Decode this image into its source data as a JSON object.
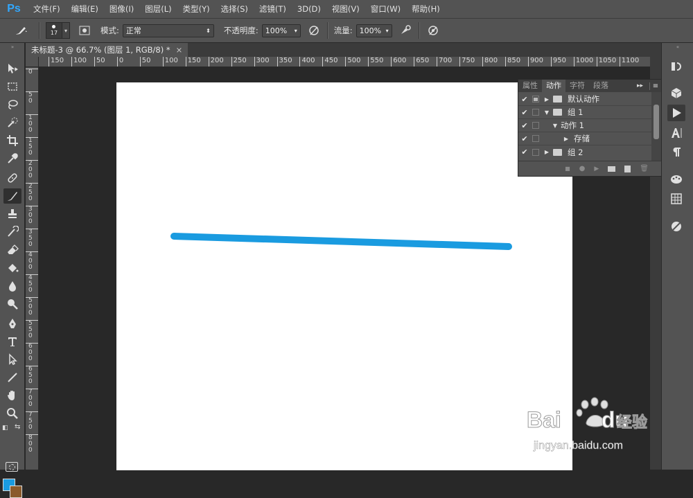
{
  "app": {
    "logo_text": "Ps"
  },
  "menu": [
    "文件(F)",
    "编辑(E)",
    "图像(I)",
    "图层(L)",
    "类型(Y)",
    "选择(S)",
    "滤镜(T)",
    "3D(D)",
    "视图(V)",
    "窗口(W)",
    "帮助(H)"
  ],
  "options": {
    "brush_size": "17",
    "mode_label": "模式:",
    "mode_value": "正常",
    "opacity_label": "不透明度:",
    "opacity_value": "100%",
    "flow_label": "流量:",
    "flow_value": "100%"
  },
  "document": {
    "tab_title": "未标题-3 @ 66.7% (图层 1, RGB/8) *",
    "close_glyph": "×"
  },
  "ruler": {
    "h_labels": [
      "150",
      "100",
      "50",
      "0",
      "50",
      "100",
      "150",
      "200",
      "250",
      "300",
      "350",
      "400",
      "450",
      "500",
      "550",
      "600",
      "650",
      "700",
      "750",
      "800",
      "850",
      "900",
      "950",
      "1000",
      "1050",
      "1100"
    ],
    "v_labels": [
      "0",
      "5 0",
      "1 0 0",
      "1 5 0",
      "2 0 0",
      "2 5 0",
      "3 0 0",
      "3 5 0",
      "4 0 0",
      "4 5 0",
      "5 0 0",
      "5 5 0",
      "6 0 0",
      "6 5 0",
      "7 0 0",
      "7 5 0",
      "8 0 0"
    ]
  },
  "actions_panel": {
    "tabs": [
      "属性",
      "动作",
      "字符",
      "段落"
    ],
    "active_tab": 1,
    "rows": [
      {
        "name": "默认动作",
        "indent": 0,
        "expanded": false,
        "folder": true,
        "dialog": true
      },
      {
        "name": "组 1",
        "indent": 0,
        "expanded": true,
        "folder": true,
        "dialog": false
      },
      {
        "name": "动作 1",
        "indent": 1,
        "expanded": true,
        "folder": false,
        "dialog": false
      },
      {
        "name": "存储",
        "indent": 2,
        "expanded": false,
        "folder": false,
        "dialog": false
      },
      {
        "name": "组 2",
        "indent": 0,
        "expanded": false,
        "folder": true,
        "dialog": false
      }
    ]
  },
  "colors": {
    "foreground": "#1a9be0",
    "background": "#8b5a2b",
    "stroke": "#1a9be0"
  },
  "watermark": {
    "brand": "Bai",
    "brand2": "du",
    "cn": "经验",
    "url": "jingyan.baidu.com"
  }
}
